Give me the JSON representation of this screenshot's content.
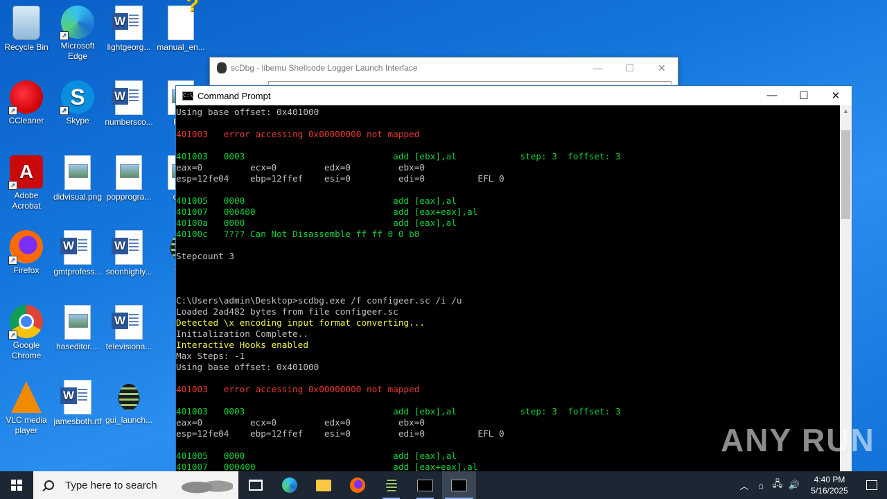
{
  "desktop": {
    "icons": [
      {
        "label": "Recycle Bin",
        "icon": "recycle-bin-icon"
      },
      {
        "label": "Microsoft Edge",
        "icon": "edge-icon"
      },
      {
        "label": "lightgeorg...",
        "icon": "word-document-icon"
      },
      {
        "label": "manual_en...",
        "icon": "help-document-icon"
      },
      {
        "label": "CCleaner",
        "icon": "ccleaner-icon"
      },
      {
        "label": "Skype",
        "icon": "skype-icon"
      },
      {
        "label": "numbersco...",
        "icon": "word-document-icon"
      },
      {
        "label": "Rea",
        "icon": "document-icon"
      },
      {
        "label": "Adobe Acrobat",
        "icon": "adobe-acrobat-icon"
      },
      {
        "label": "didvisual.png",
        "icon": "image-file-icon"
      },
      {
        "label": "popprogra...",
        "icon": "image-file-icon"
      },
      {
        "label": "conf",
        "icon": "document-icon"
      },
      {
        "label": "Firefox",
        "icon": "firefox-icon"
      },
      {
        "label": "gmtprofess...",
        "icon": "word-document-icon"
      },
      {
        "label": "soonhighly...",
        "icon": "word-document-icon"
      },
      {
        "label": "scd",
        "icon": "document-icon"
      },
      {
        "label": "Google Chrome",
        "icon": "chrome-icon"
      },
      {
        "label": "haseditor....",
        "icon": "image-file-icon"
      },
      {
        "label": "televisiona...",
        "icon": "word-document-icon"
      },
      {
        "label": "VLC media player",
        "icon": "vlc-icon"
      },
      {
        "label": "jamesboth.rtf",
        "icon": "word-document-icon"
      },
      {
        "label": "gui_launch...",
        "icon": "scdbg-bug-icon"
      }
    ]
  },
  "scdbg_window": {
    "title": "scDbg - libemu Shellcode Logger Launch Interface",
    "minimize": "—",
    "maximize": "☐",
    "close": "✕"
  },
  "cmd_window": {
    "title": "Command Prompt",
    "minimize": "—",
    "maximize": "☐",
    "close": "✕",
    "icon_text": "C:\\",
    "lines": [
      {
        "text": "Using base offset: 0x401000",
        "color": "gray"
      },
      {
        "text": "",
        "color": "gray"
      },
      {
        "text": "401003   error accessing 0x00000000 not mapped",
        "color": "red"
      },
      {
        "text": "",
        "color": "gray"
      },
      {
        "text": "401003   0003                            add [ebx],al            step: 3  foffset: 3",
        "color": "green"
      },
      {
        "text": "eax=0         ecx=0         edx=0         ebx=0",
        "color": "gray"
      },
      {
        "text": "esp=12fe04    ebp=12ffef    esi=0         edi=0          EFL 0",
        "color": "gray"
      },
      {
        "text": "",
        "color": "gray"
      },
      {
        "text": "401005   0000                            add [eax],al",
        "color": "green"
      },
      {
        "text": "401007   000400                          add [eax+eax],al",
        "color": "green"
      },
      {
        "text": "40100a   0000                            add [eax],al",
        "color": "green"
      },
      {
        "text": "40100c   ???? Can Not Disassemble ff ff 0 0 b8",
        "color": "green"
      },
      {
        "text": "",
        "color": "gray"
      },
      {
        "text": "Stepcount 3",
        "color": "gray"
      },
      {
        "text": "",
        "color": "gray"
      },
      {
        "text": "",
        "color": "gray"
      },
      {
        "text": "",
        "color": "gray"
      },
      {
        "text": "C:\\Users\\admin\\Desktop>scdbg.exe /f configeer.sc /i /u",
        "color": "gray"
      },
      {
        "text": "Loaded 2ad482 bytes from file configeer.sc",
        "color": "gray"
      },
      {
        "text": "Detected \\x encoding input format converting...",
        "color": "yellow"
      },
      {
        "text": "Initialization Complete..",
        "color": "gray"
      },
      {
        "text": "Interactive Hooks enabled",
        "color": "yellow"
      },
      {
        "text": "Max Steps: -1",
        "color": "gray"
      },
      {
        "text": "Using base offset: 0x401000",
        "color": "gray"
      },
      {
        "text": "",
        "color": "gray"
      },
      {
        "text": "401003   error accessing 0x00000000 not mapped",
        "color": "red"
      },
      {
        "text": "",
        "color": "gray"
      },
      {
        "text": "401003   0003                            add [ebx],al            step: 3  foffset: 3",
        "color": "green"
      },
      {
        "text": "eax=0         ecx=0         edx=0         ebx=0",
        "color": "gray"
      },
      {
        "text": "esp=12fe04    ebp=12ffef    esi=0         edi=0          EFL 0",
        "color": "gray"
      },
      {
        "text": "",
        "color": "gray"
      },
      {
        "text": "401005   0000                            add [eax],al",
        "color": "green"
      },
      {
        "text": "401007   000400                          add [eax+eax],al",
        "color": "green"
      }
    ]
  },
  "watermark": "ANY RUN",
  "taskbar": {
    "search_placeholder": "Type here to search",
    "clock_time": "4:40 PM",
    "clock_date": "5/16/2025",
    "tray_chevron": "︿",
    "tray_network": "🖧",
    "tray_volume": "🔊"
  },
  "colors": {
    "desktop": "#1477dd",
    "console_bg": "#000000",
    "console_red": "#e8392f",
    "console_green": "#13d13a",
    "console_yellow": "#f2f24a",
    "taskbar": "#1c2733"
  }
}
